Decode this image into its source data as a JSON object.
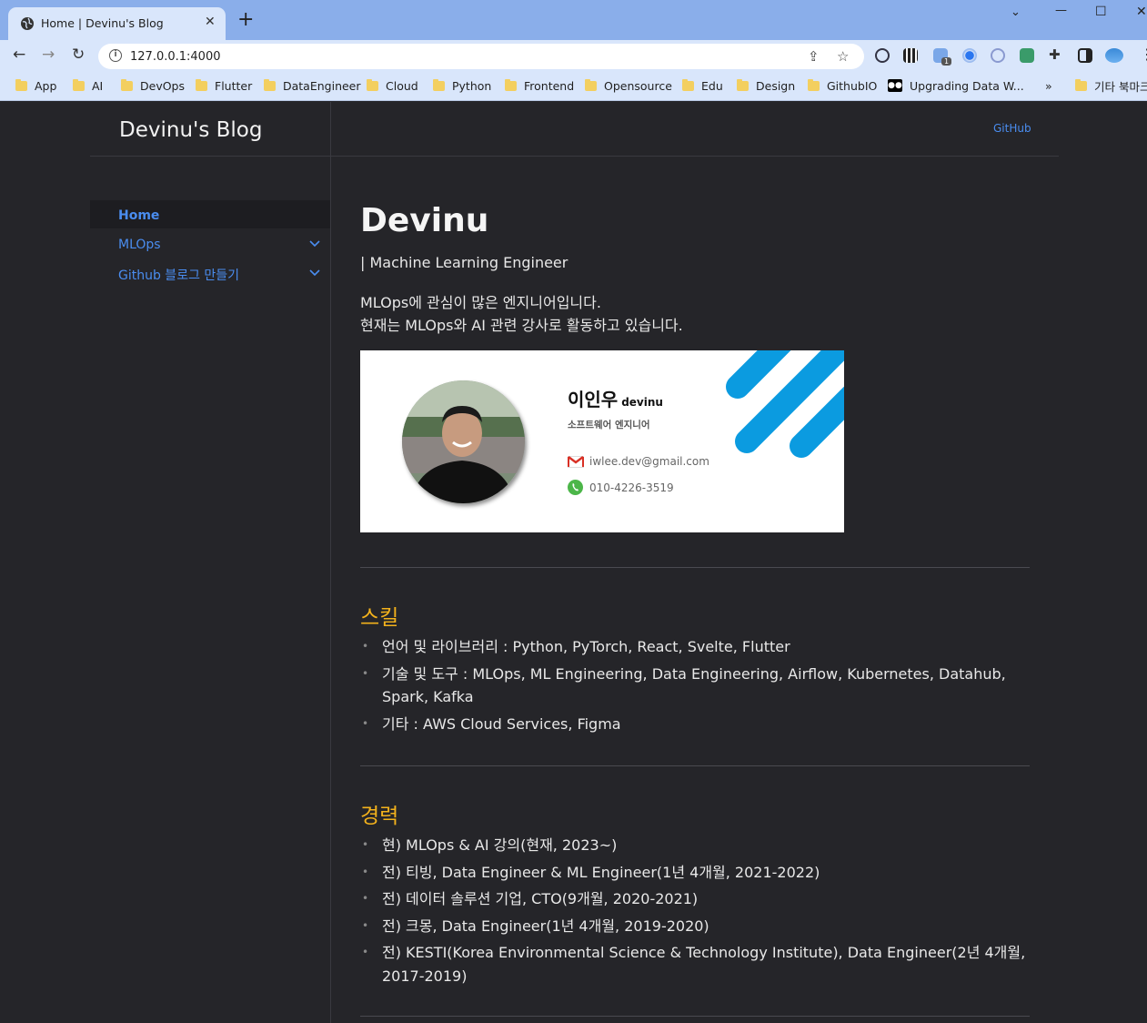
{
  "browser": {
    "tab_title": "Home | Devinu's Blog",
    "url": "127.0.0.1:4000",
    "extension_badge": "1",
    "bookmarks": [
      "App",
      "AI",
      "DevOps",
      "Flutter",
      "DataEngineer",
      "Cloud",
      "Python",
      "Frontend",
      "Opensource",
      "Edu",
      "Design",
      "GithubIO"
    ],
    "bookmark_medium": "Upgrading Data W...",
    "bookmark_more": "»",
    "bookmark_other": "기타 북마크"
  },
  "header": {
    "site_title": "Devinu's Blog",
    "github_link": "GitHub"
  },
  "sidebar": {
    "items": [
      {
        "label": "Home"
      },
      {
        "label": "MLOps"
      },
      {
        "label": "Github 블로그 만들기"
      }
    ]
  },
  "main": {
    "title": "Devinu",
    "subtitle": "| Machine Learning Engineer",
    "intro_line1": "MLOps에 관심이 많은 엔지니어입니다.",
    "intro_line2": "현재는 MLOps와 AI 관련 강사로 활동하고 있습니다.",
    "card": {
      "name": "이인우",
      "nickname": "devinu",
      "role": "소프트웨어 엔지니어",
      "email": "iwlee.dev@gmail.com",
      "phone": "010-4226-3519"
    },
    "skills": {
      "heading": "스킬",
      "items": [
        "언어 및 라이브러리 : Python, PyTorch, React, Svelte, Flutter",
        "기술 및 도구 : MLOps, ML Engineering, Data Engineering, Airflow, Kubernetes, Datahub, Spark, Kafka",
        "기타 : AWS Cloud Services, Figma"
      ]
    },
    "career": {
      "heading": "경력",
      "items": [
        "현) MLOps & AI 강의(현재, 2023~)",
        "전) 티빙, Data Engineer & ML Engineer(1년 4개월, 2021-2022)",
        "전) 데이터 솔루션 기업, CTO(9개월, 2020-2021)",
        "전) 크몽, Data Engineer(1년 4개월, 2019-2020)",
        "전) KESTI(Korea Environmental Science & Technology Institute), Data Engineer(2년 4개월, 2017-2019)"
      ]
    }
  },
  "colors": {
    "link": "#4a8df0",
    "heading_accent": "#f3b21c",
    "page_bg": "#252529",
    "card_stripes": "#0b9be0"
  }
}
